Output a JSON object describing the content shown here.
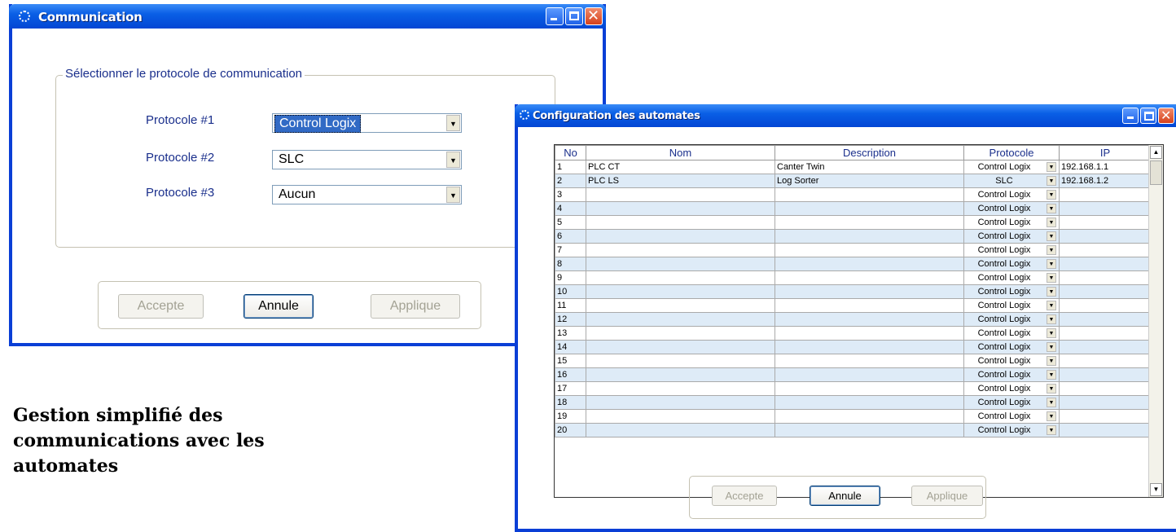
{
  "window1": {
    "title": "Communication",
    "group_title": "Sélectionner le protocole de communication",
    "protocols": [
      {
        "label": "Protocole #1",
        "value": "Control Logix"
      },
      {
        "label": "Protocole #2",
        "value": "SLC"
      },
      {
        "label": "Protocole #3",
        "value": "Aucun"
      }
    ],
    "buttons": {
      "accept": "Accepte",
      "cancel": "Annule",
      "apply": "Applique"
    }
  },
  "window2": {
    "title": "Configuration des automates",
    "columns": [
      "No",
      "Nom",
      "Description",
      "Protocole",
      "IP"
    ],
    "rows": [
      {
        "no": "1",
        "nom": "PLC CT",
        "desc": "Canter Twin",
        "proto": "Control Logix",
        "ip": "192.168.1.1"
      },
      {
        "no": "2",
        "nom": "PLC LS",
        "desc": "Log Sorter",
        "proto": "SLC",
        "ip": "192.168.1.2"
      },
      {
        "no": "3",
        "nom": "",
        "desc": "",
        "proto": "Control Logix",
        "ip": ""
      },
      {
        "no": "4",
        "nom": "",
        "desc": "",
        "proto": "Control Logix",
        "ip": ""
      },
      {
        "no": "5",
        "nom": "",
        "desc": "",
        "proto": "Control Logix",
        "ip": ""
      },
      {
        "no": "6",
        "nom": "",
        "desc": "",
        "proto": "Control Logix",
        "ip": ""
      },
      {
        "no": "7",
        "nom": "",
        "desc": "",
        "proto": "Control Logix",
        "ip": ""
      },
      {
        "no": "8",
        "nom": "",
        "desc": "",
        "proto": "Control Logix",
        "ip": ""
      },
      {
        "no": "9",
        "nom": "",
        "desc": "",
        "proto": "Control Logix",
        "ip": ""
      },
      {
        "no": "10",
        "nom": "",
        "desc": "",
        "proto": "Control Logix",
        "ip": ""
      },
      {
        "no": "11",
        "nom": "",
        "desc": "",
        "proto": "Control Logix",
        "ip": ""
      },
      {
        "no": "12",
        "nom": "",
        "desc": "",
        "proto": "Control Logix",
        "ip": ""
      },
      {
        "no": "13",
        "nom": "",
        "desc": "",
        "proto": "Control Logix",
        "ip": ""
      },
      {
        "no": "14",
        "nom": "",
        "desc": "",
        "proto": "Control Logix",
        "ip": ""
      },
      {
        "no": "15",
        "nom": "",
        "desc": "",
        "proto": "Control Logix",
        "ip": ""
      },
      {
        "no": "16",
        "nom": "",
        "desc": "",
        "proto": "Control Logix",
        "ip": ""
      },
      {
        "no": "17",
        "nom": "",
        "desc": "",
        "proto": "Control Logix",
        "ip": ""
      },
      {
        "no": "18",
        "nom": "",
        "desc": "",
        "proto": "Control Logix",
        "ip": ""
      },
      {
        "no": "19",
        "nom": "",
        "desc": "",
        "proto": "Control Logix",
        "ip": ""
      },
      {
        "no": "20",
        "nom": "",
        "desc": "",
        "proto": "Control Logix",
        "ip": ""
      }
    ],
    "buttons": {
      "accept": "Accepte",
      "cancel": "Annule",
      "apply": "Applique"
    }
  },
  "caption": "Gestion simplifié des communications avec les automates",
  "colors": {
    "titlebar": "#0a5fe6",
    "label_text": "#1a2f8c",
    "row_alt": "#deebf7",
    "selection": "#316ac5"
  },
  "icons": [
    "app-icon",
    "minimize-icon",
    "maximize-icon",
    "close-icon",
    "dropdown-arrow-icon",
    "scroll-up-icon",
    "scroll-down-icon"
  ]
}
